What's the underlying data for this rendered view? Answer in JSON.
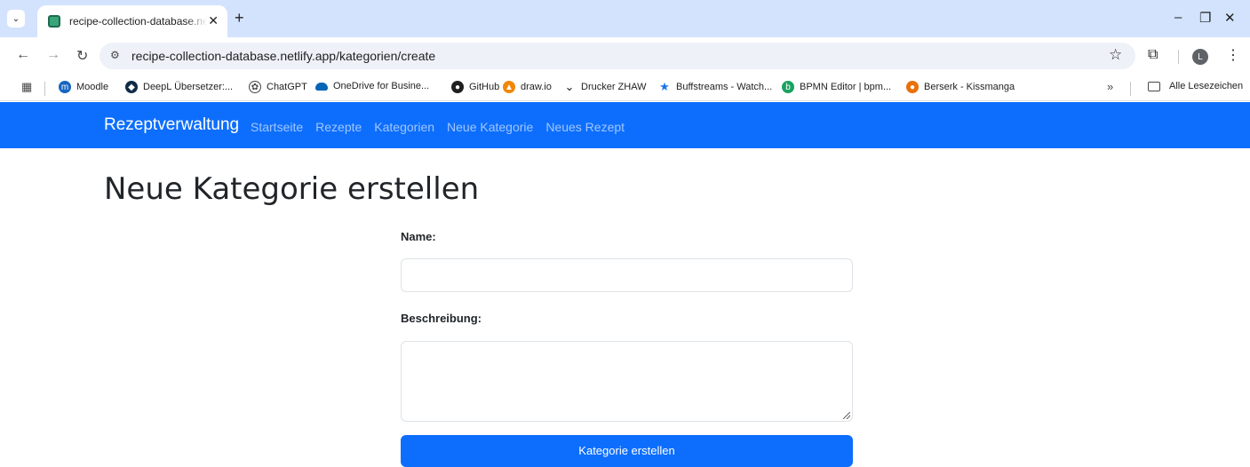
{
  "browser": {
    "tab_title": "recipe-collection-database.netlify.app",
    "url": "recipe-collection-database.netlify.app/kategorien/create",
    "profile_initial": "L",
    "bookmarks": [
      {
        "label": "Moodle",
        "icon": "moodle-icon",
        "color": "#1565c0"
      },
      {
        "label": "DeepL Übersetzer:...",
        "icon": "deepl-icon",
        "color": "#0f2b46"
      },
      {
        "label": "ChatGPT",
        "icon": "chatgpt-icon",
        "color": "#444444"
      },
      {
        "label": "OneDrive for Busine...",
        "icon": "onedrive-icon",
        "color": "#0364b8"
      },
      {
        "label": "GitHub",
        "icon": "github-icon",
        "color": "#1f1f1f"
      },
      {
        "label": "draw.io",
        "icon": "drawio-icon",
        "color": "#f08705"
      },
      {
        "label": "Drucker ZHAW",
        "icon": "drucker-icon",
        "color": "#1f1f1f"
      },
      {
        "label": "Buffstreams - Watch...",
        "icon": "star-bookmark-icon",
        "color": "#1a73e8"
      },
      {
        "label": "BPMN Editor | bpm...",
        "icon": "bpmn-icon",
        "color": "#1aa260"
      },
      {
        "label": "Berserk - Kissmanga",
        "icon": "kissmanga-icon",
        "color": "#e8710a"
      }
    ],
    "all_bookmarks_label": "Alle Lesezeichen"
  },
  "navbar": {
    "brand": "Rezeptverwaltung",
    "links": [
      "Startseite",
      "Rezepte",
      "Kategorien",
      "Neue Kategorie",
      "Neues Rezept"
    ],
    "color": "#0d6efd"
  },
  "page": {
    "title": "Neue Kategorie erstellen"
  },
  "form": {
    "name_label": "Name:",
    "name_value": "",
    "description_label": "Beschreibung:",
    "description_value": "",
    "submit_label": "Kategorie erstellen"
  }
}
